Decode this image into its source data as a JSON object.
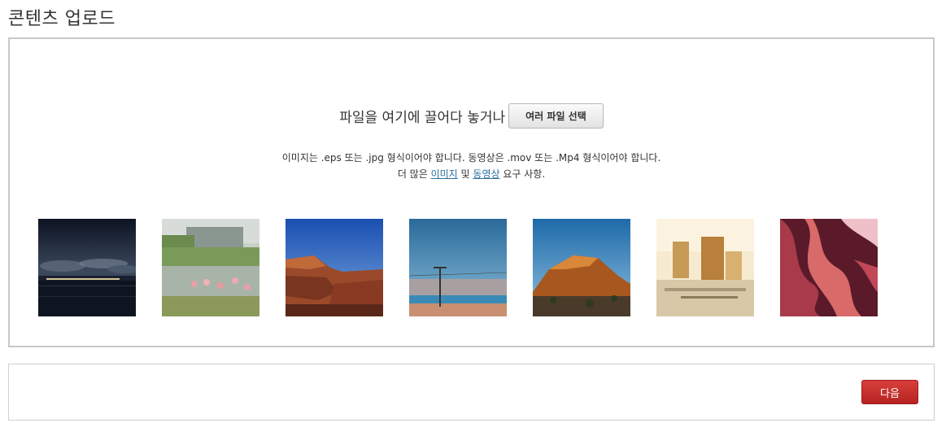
{
  "page": {
    "title": "콘텐츠 업로드"
  },
  "drop_zone": {
    "prompt": "파일을 여기에 끌어다 놓거나",
    "select_button": "여러 파일 선택",
    "requirements": "이미지는 .eps 또는 .jpg 형식이어야 합니다. 동영상은 .mov 또는 .Mp4 형식이어야 합니다.",
    "more_prefix": "더 많은",
    "images_link": "이미지",
    "and_text": "및",
    "videos_link": "동영상",
    "more_suffix": "요구 사항."
  },
  "thumbnails": [
    "night-harbor-photo",
    "flamingos-photo",
    "red-rock-cliff-photo",
    "lake-power-pole-photo",
    "desert-butte-photo",
    "las-vegas-strip-photo",
    "antelope-canyon-photo"
  ],
  "footer": {
    "next_button": "다음"
  },
  "colors": {
    "next_button_bg": "#c42d2a",
    "link": "#2a6f9e",
    "border": "#c8c8c8"
  }
}
